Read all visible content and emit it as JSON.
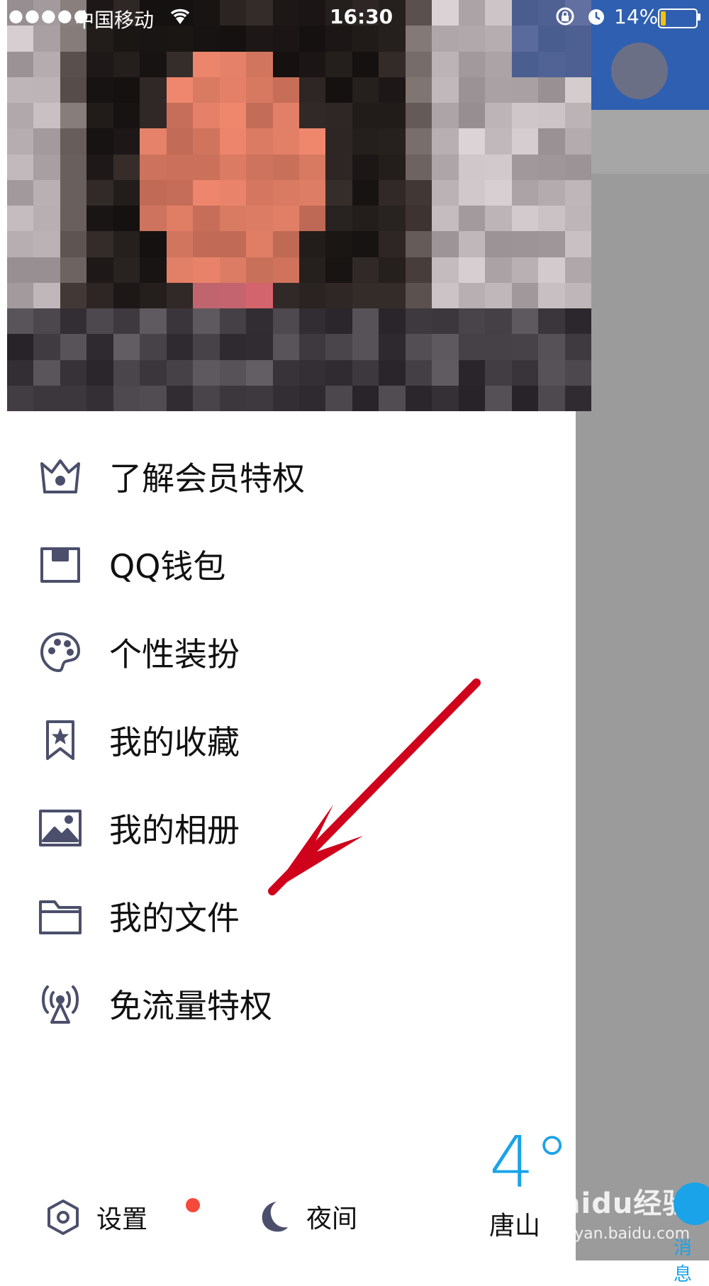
{
  "status_bar": {
    "signal": "●●●●●",
    "carrier": "中国移动",
    "time": "16:30",
    "battery_percent": "14%",
    "battery_level": 0.14
  },
  "menu": {
    "items": [
      {
        "label": "了解会员特权",
        "icon": "crown-icon"
      },
      {
        "label": "QQ钱包",
        "icon": "wallet-icon"
      },
      {
        "label": "个性装扮",
        "icon": "palette-icon"
      },
      {
        "label": "我的收藏",
        "icon": "bookmark-star-icon"
      },
      {
        "label": "我的相册",
        "icon": "photo-icon"
      },
      {
        "label": "我的文件",
        "icon": "folder-icon"
      },
      {
        "label": "免流量特权",
        "icon": "signal-tower-icon"
      }
    ]
  },
  "bottom_bar": {
    "settings_label": "设置",
    "night_label": "夜间"
  },
  "weather": {
    "temperature": "4°",
    "city": "唐山"
  },
  "background": {
    "message_tab_label": "消息",
    "watermark": "Baidu经验",
    "watermark_url": "jingyan.baidu.com"
  },
  "colors": {
    "accent": "#1aa3e8",
    "notification_dot": "#f5493b",
    "arrow": "#d0021b",
    "icon_color": "#4b4f6b"
  }
}
